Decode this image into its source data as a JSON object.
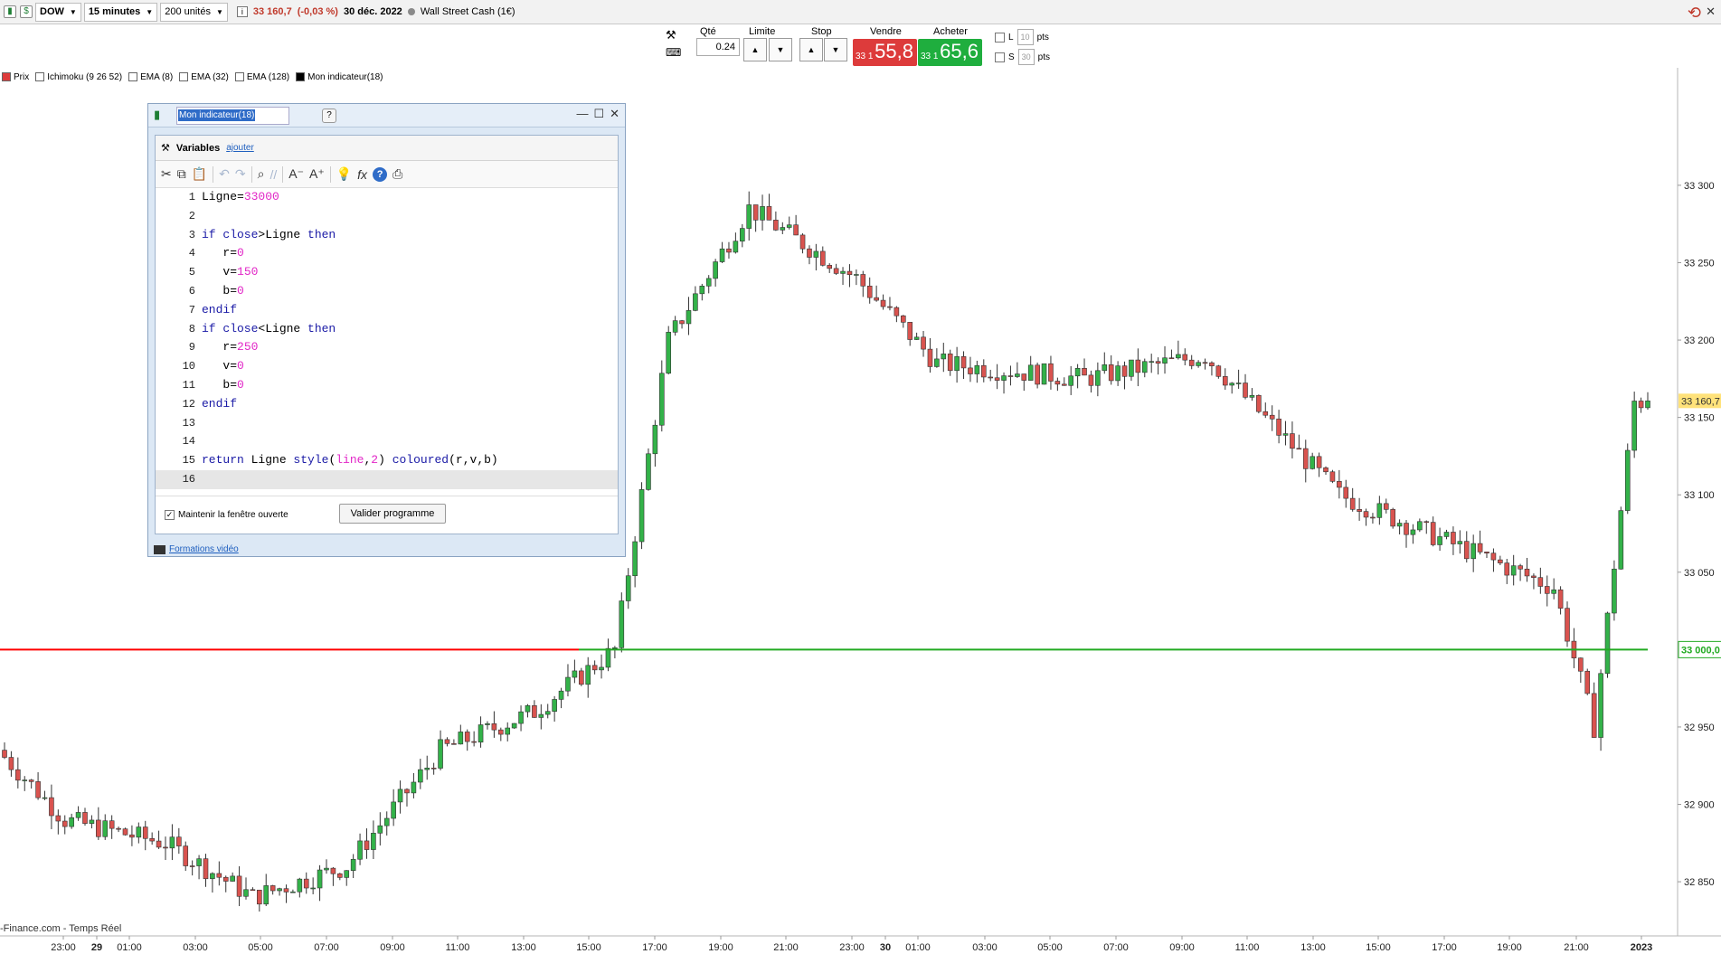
{
  "toolbar": {
    "instrument": "DOW",
    "timeframe": "15 minutes",
    "units": "200 unités",
    "price": "33 160,7",
    "change": "(-0,03 %)",
    "date": "30 déc. 2022",
    "market": "Wall Street Cash (1€)"
  },
  "order": {
    "qty_label": "Qté",
    "qty_value": "0.24",
    "limit_label": "Limite",
    "stop_label": "Stop",
    "sell_label": "Vendre",
    "buy_label": "Acheter",
    "sell_small": "33 1",
    "sell_big": "55,8",
    "buy_small": "33 1",
    "buy_big": "65,6",
    "l_label": "L",
    "s_label": "S",
    "l_pts": "10",
    "s_pts": "30",
    "pts": "pts"
  },
  "legend": [
    "Prix",
    "Ichimoku (9 26 52)",
    "EMA (8)",
    "EMA (32)",
    "EMA (128)",
    "Mon indicateur(18)"
  ],
  "chart_data": {
    "type": "candlestick",
    "x_ticks": [
      "23:00",
      "29",
      "01:00",
      "03:00",
      "05:00",
      "07:00",
      "09:00",
      "11:00",
      "13:00",
      "15:00",
      "17:00",
      "19:00",
      "21:00",
      "23:00",
      "30",
      "01:00",
      "03:00",
      "05:00",
      "07:00",
      "09:00",
      "11:00",
      "13:00",
      "15:00",
      "17:00",
      "19:00",
      "21:00",
      "2023"
    ],
    "y_ticks": [
      "33 300",
      "33 250",
      "33 200",
      "33 150",
      "33 100",
      "33 050",
      "32 950",
      "32 900",
      "32 850"
    ],
    "ylim": [
      32815,
      33335
    ],
    "current_price_label": "33 160,7",
    "line_label": "33 000,0",
    "line_value": 33000,
    "colors": {
      "up": "#33b249",
      "down": "#d9534f",
      "below": "#ff0000",
      "above": "#22aa22"
    },
    "footer": "-Finance.com - Temps Réel"
  },
  "editor": {
    "title": "Mon indicateur(18)",
    "variables_label": "Variables",
    "add_link": "ajouter",
    "lines": [
      [
        {
          "t": "Ligne="
        },
        {
          "t": "33000",
          "c": "nm"
        }
      ],
      [],
      [
        {
          "t": "if ",
          "c": "kw"
        },
        {
          "t": "close",
          "c": "kw"
        },
        {
          "t": ">Ligne "
        },
        {
          "t": "then",
          "c": "kw"
        }
      ],
      [
        {
          "t": "   r="
        },
        {
          "t": "0",
          "c": "nm"
        }
      ],
      [
        {
          "t": "   v="
        },
        {
          "t": "150",
          "c": "nm"
        }
      ],
      [
        {
          "t": "   b="
        },
        {
          "t": "0",
          "c": "nm"
        }
      ],
      [
        {
          "t": "endif",
          "c": "kw"
        }
      ],
      [
        {
          "t": "if ",
          "c": "kw"
        },
        {
          "t": "close",
          "c": "kw"
        },
        {
          "t": "<Ligne "
        },
        {
          "t": "then",
          "c": "kw"
        }
      ],
      [
        {
          "t": "   r="
        },
        {
          "t": "250",
          "c": "nm"
        }
      ],
      [
        {
          "t": "   v="
        },
        {
          "t": "0",
          "c": "nm"
        }
      ],
      [
        {
          "t": "   b="
        },
        {
          "t": "0",
          "c": "nm"
        }
      ],
      [
        {
          "t": "endif",
          "c": "kw"
        }
      ],
      [],
      [],
      [
        {
          "t": "return ",
          "c": "kw"
        },
        {
          "t": "Ligne "
        },
        {
          "t": "style",
          "c": "kw"
        },
        {
          "t": "("
        },
        {
          "t": "line",
          "c": "nm"
        },
        {
          "t": ","
        },
        {
          "t": "2",
          "c": "nm"
        },
        {
          "t": ") "
        },
        {
          "t": "coloured",
          "c": "kw"
        },
        {
          "t": "(r,v,b)"
        }
      ],
      []
    ],
    "keep_open_label": "Maintenir la fenêtre ouverte",
    "validate_label": "Valider programme",
    "video_link": "Formations vidéo"
  }
}
